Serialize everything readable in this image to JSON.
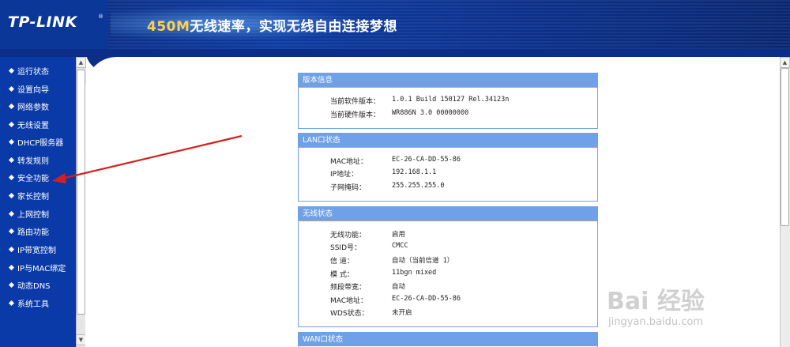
{
  "header": {
    "brand": "TP-LINK",
    "brand_mark": "®",
    "slogan_highlight": "450M",
    "slogan_text": "无线速率，实现无线自由连接梦想"
  },
  "sidebar": {
    "items": [
      {
        "label": "运行状态"
      },
      {
        "label": "设置向导"
      },
      {
        "label": "网络参数"
      },
      {
        "label": "无线设置"
      },
      {
        "label": "DHCP服务器"
      },
      {
        "label": "转发规则"
      },
      {
        "label": "安全功能"
      },
      {
        "label": "家长控制"
      },
      {
        "label": "上网控制"
      },
      {
        "label": "路由功能"
      },
      {
        "label": "IP带宽控制"
      },
      {
        "label": "IP与MAC绑定"
      },
      {
        "label": "动态DNS"
      },
      {
        "label": "系统工具"
      }
    ]
  },
  "panels": {
    "version": {
      "title": "版本信息",
      "rows": [
        {
          "key": "当前软件版本：",
          "value": "1.0.1 Build 150127 Rel.34123n"
        },
        {
          "key": "当前硬件版本：",
          "value": "WR886N 3.0 00000000"
        }
      ]
    },
    "lan": {
      "title": "LAN口状态",
      "rows": [
        {
          "key": "MAC地址：",
          "value": "EC-26-CA-DD-55-86"
        },
        {
          "key": "IP地址：",
          "value": "192.168.1.1"
        },
        {
          "key": "子网掩码：",
          "value": "255.255.255.0"
        }
      ]
    },
    "wireless": {
      "title": "无线状态",
      "rows": [
        {
          "key": "无线功能：",
          "value": "启用"
        },
        {
          "key": "SSID号：",
          "value": "CMCC"
        },
        {
          "key": "信 道：",
          "value": "自动（当前信道 1）"
        },
        {
          "key": "模 式：",
          "value": "11bgn mixed"
        },
        {
          "key": "频段带宽：",
          "value": "自动"
        },
        {
          "key": "MAC地址：",
          "value": "EC-26-CA-DD-55-86"
        },
        {
          "key": "WDS状态：",
          "value": "未开启"
        }
      ]
    },
    "wan": {
      "title": "WAN口状态"
    }
  },
  "watermark": {
    "text": "Bai 经验",
    "url": "jingyan.baidu.com"
  },
  "colors": {
    "sidebar_bg": "#0a3aa8",
    "panel_title_bg": "#6fa0e8",
    "arrow": "#d42020"
  }
}
